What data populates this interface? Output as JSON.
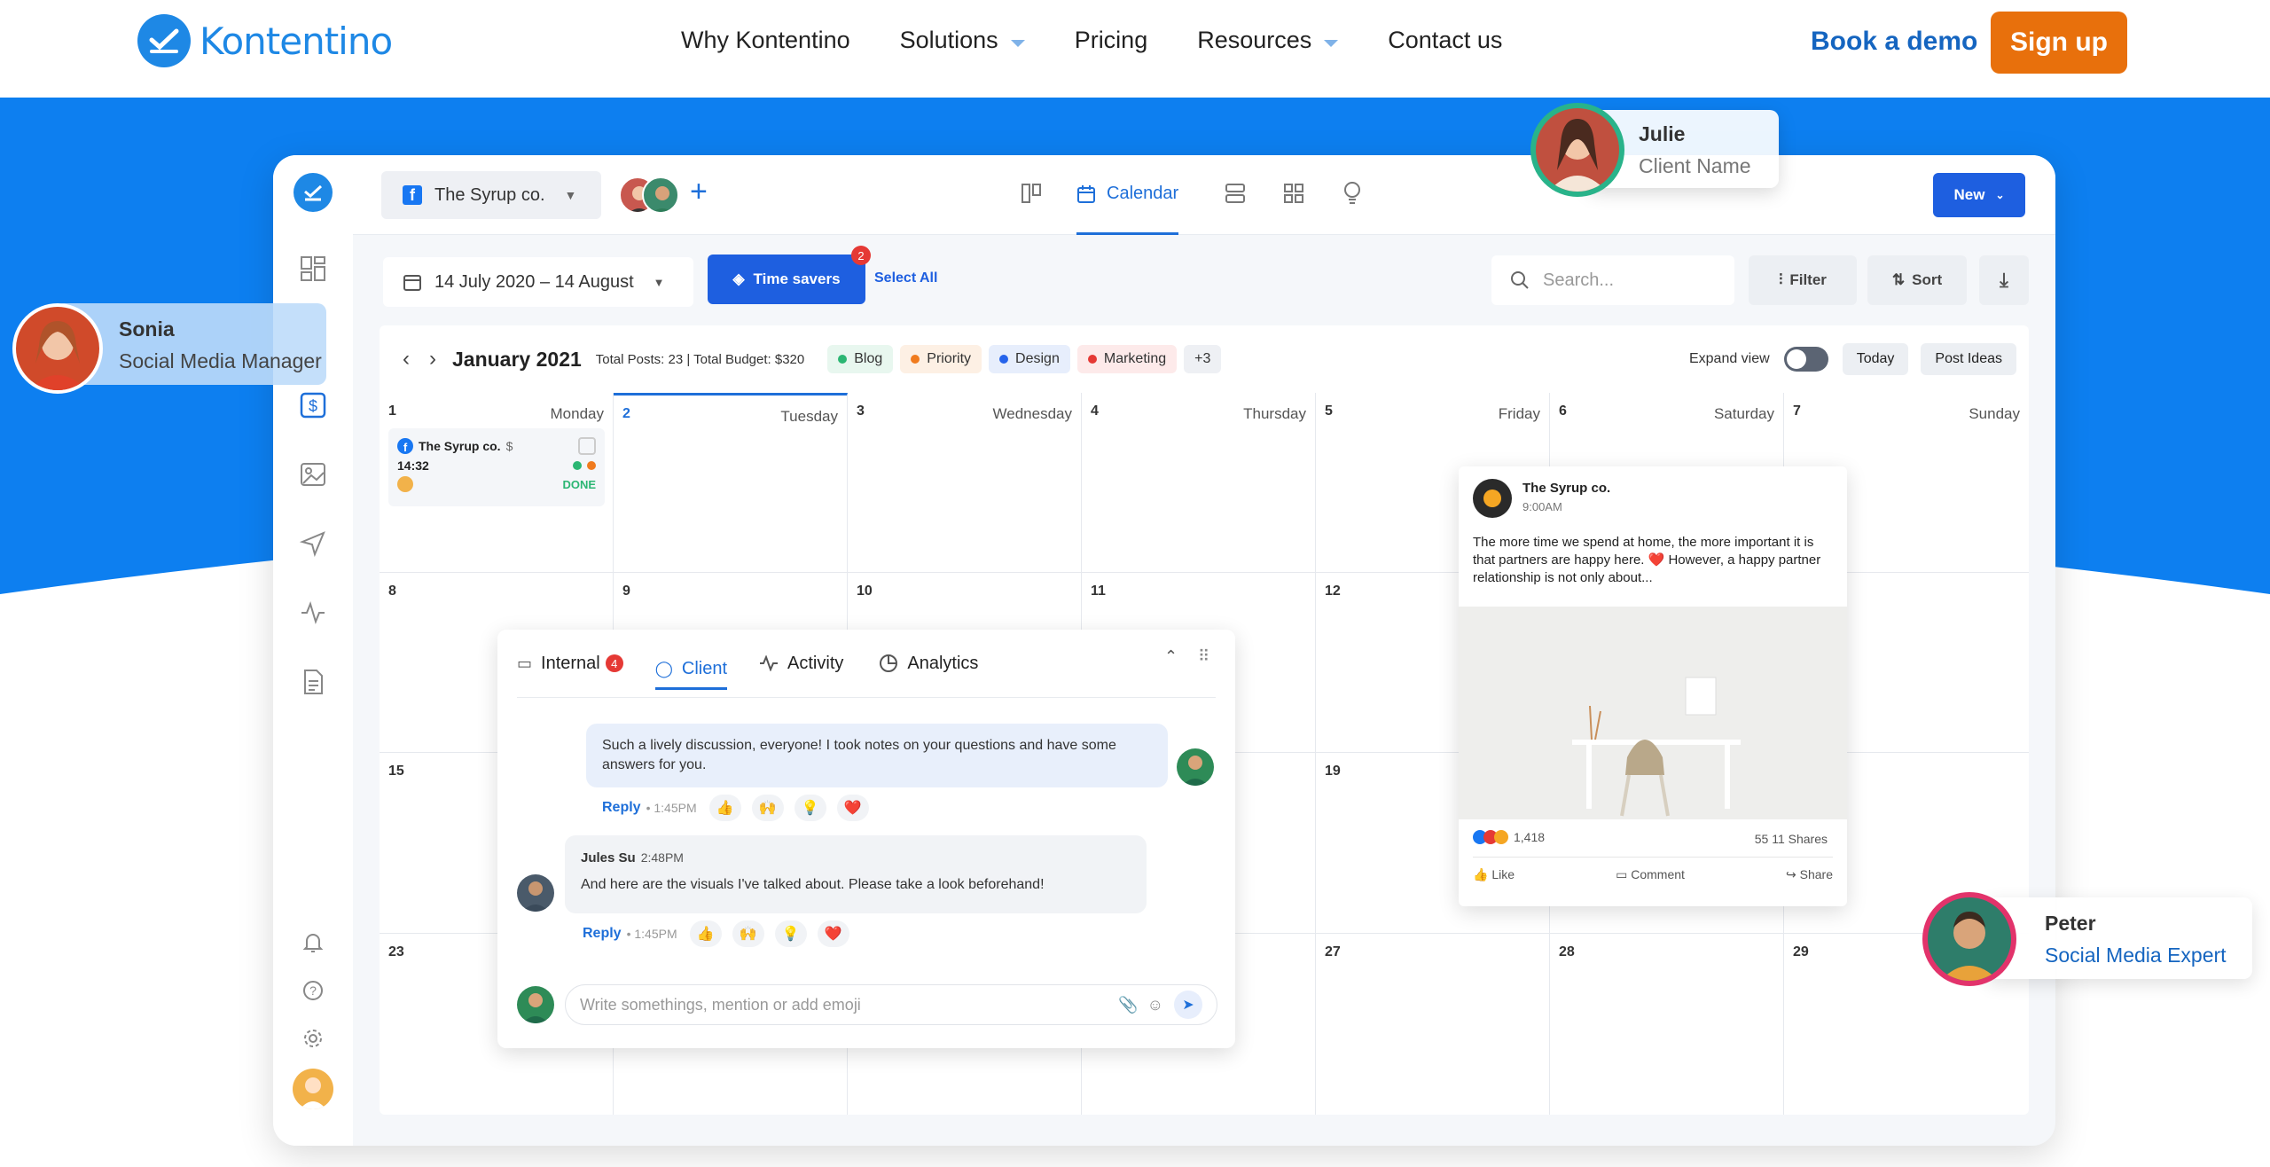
{
  "brand": {
    "name": "Kontentino",
    "accent": "#1e88e5",
    "hero_bg": "#0d7ff0",
    "cta": "#e8700c"
  },
  "nav": {
    "items": [
      "Why Kontentino",
      "Solutions",
      "Pricing",
      "Resources",
      "Contact us"
    ],
    "book": "Book a demo",
    "signup": "Sign up"
  },
  "app": {
    "page_selector": "The Syrup co.",
    "views": {
      "calendar": "Calendar"
    },
    "new_button": "New",
    "date_range": "14 July 2020 – 14 August",
    "time_savers": "Time savers",
    "time_savers_badge": "2",
    "select_all": "Select All",
    "search_placeholder": "Search...",
    "filter": "Filter",
    "sort": "Sort",
    "month": "January 2021",
    "stats": "Total Posts: 23 | Total Budget: $320",
    "labels": [
      {
        "name": "Blog",
        "color": "#2bb673",
        "bg": "#e8f7ef"
      },
      {
        "name": "Priority",
        "color": "#f07b1e",
        "bg": "#fdf0e4"
      },
      {
        "name": "Design",
        "color": "#2563eb",
        "bg": "#e7eefc"
      },
      {
        "name": "Marketing",
        "color": "#e53935",
        "bg": "#fdeaea"
      }
    ],
    "labels_more": "+3",
    "expand_view": "Expand view",
    "today": "Today",
    "post_ideas": "Post Ideas",
    "week1": [
      {
        "n": "1",
        "d": "Monday"
      },
      {
        "n": "2",
        "d": "Tuesday"
      },
      {
        "n": "3",
        "d": "Wednesday"
      },
      {
        "n": "4",
        "d": "Thursday"
      },
      {
        "n": "5",
        "d": "Friday"
      },
      {
        "n": "6",
        "d": "Saturday"
      },
      {
        "n": "7",
        "d": "Sunday"
      }
    ],
    "rows": [
      [
        "8",
        "9",
        "10",
        "11",
        "12",
        "",
        ""
      ],
      [
        "15",
        "",
        "",
        "",
        "19",
        "",
        ""
      ],
      [
        "23",
        "",
        "",
        "",
        "27",
        "28",
        "29"
      ]
    ],
    "post_card": {
      "page": "The Syrup co.",
      "currency": "$",
      "time": "14:32",
      "status": "DONE"
    }
  },
  "chat": {
    "tabs": {
      "internal": "Internal",
      "internal_badge": "4",
      "client": "Client",
      "activity": "Activity",
      "analytics": "Analytics"
    },
    "msg1": "Such a lively discussion, everyone! I took notes on your questions and have some answers for you.",
    "msg1_meta": "• 1:45PM",
    "author2": "Jules Su",
    "author2_time": "2:48PM",
    "msg2": "And here are the visuals I've talked about. Please take a look beforehand!",
    "msg2_meta": "• 1:45PM",
    "reply": "Reply",
    "input_placeholder": "Write somethings, mention or add emoji"
  },
  "fb_post": {
    "page": "The Syrup co.",
    "time": "9:00AM",
    "text": "The more time we spend at home, the more important it is that partners are happy here. ❤️ However, a happy partner relationship is not only about...",
    "reactions": "1,418",
    "shares": "55  11 Shares",
    "like": "Like",
    "comment": "Comment",
    "share": "Share"
  },
  "people": {
    "julie": {
      "name": "Julie",
      "role": "Client Name"
    },
    "sonia": {
      "name": "Sonia",
      "role": "Social Media Manager"
    },
    "peter": {
      "name": "Peter",
      "role": "Social Media Expert"
    }
  }
}
